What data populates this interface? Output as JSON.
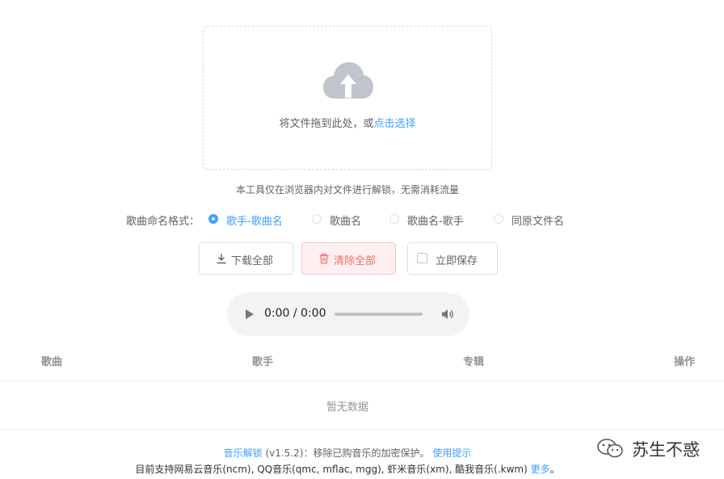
{
  "upload": {
    "hint": "将文件拖到此处，或",
    "link": "点击选择"
  },
  "tip": "本工具仅在浏览器内对文件进行解锁，无需消耗流量",
  "naming": {
    "label": "歌曲命名格式：",
    "options": [
      {
        "label": "歌手-歌曲名",
        "checked": true
      },
      {
        "label": "歌曲名",
        "checked": false
      },
      {
        "label": "歌曲名-歌手",
        "checked": false
      },
      {
        "label": "同原文件名",
        "checked": false
      }
    ]
  },
  "buttons": {
    "download_all": "下载全部",
    "clear_all": "清除全部",
    "save_now": "立即保存"
  },
  "player": {
    "time": "0:00 / 0:00"
  },
  "table": {
    "columns": [
      "歌曲",
      "歌手",
      "专辑",
      "操作"
    ],
    "empty_text": "暂无数据"
  },
  "footer": {
    "app_link": "音乐解锁",
    "version_desc": " (v1.5.2)：移除已购音乐的加密保护。 ",
    "help_link": "使用提示",
    "support": "目前支持网易云音乐(ncm), QQ音乐(qmc, mflac, mgg), 虾米音乐(xm), 酷我音乐(.kwm) ",
    "more_link": "更多",
    "period": "。"
  },
  "watermark": "苏生不惑",
  "colors": {
    "primary": "#409eff",
    "danger": "#f56c6c",
    "text": "#606266",
    "muted": "#909399"
  }
}
